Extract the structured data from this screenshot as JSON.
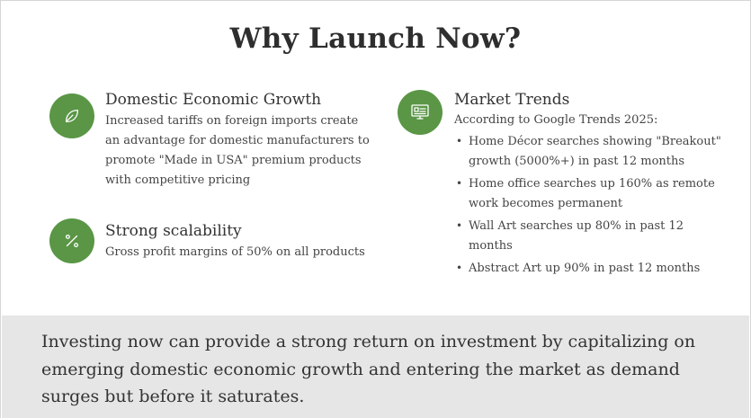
{
  "title": "Why Launch Now?",
  "left": {
    "block1": {
      "icon": "leaf-icon",
      "title": "Domestic Economic Growth",
      "text": "Increased tariffs on foreign imports create an advantage for domestic manufacturers to promote \"Made in USA\" premium products with competitive pricing"
    },
    "block2": {
      "icon": "percent-icon",
      "title": "Strong scalability",
      "text": "Gross profit margins of 50% on all products"
    }
  },
  "right": {
    "block1": {
      "icon": "presentation-icon",
      "title": "Market Trends",
      "intro": "According to Google Trends 2025:",
      "bullets": [
        "Home Décor searches showing \"Breakout\" growth (5000%+) in past 12 months",
        "Home office searches up 160% as remote work becomes permanent",
        "Wall Art searches up 80% in past 12 months",
        "Abstract Art up 90% in past 12 months"
      ]
    }
  },
  "footer": {
    "text": "Investing now can provide a strong return on investment by capitalizing on emerging domestic economic growth and entering the market as demand surges but before it saturates."
  },
  "colors": {
    "accent": "#5a9645",
    "footer_bg": "#e6e6e6"
  }
}
